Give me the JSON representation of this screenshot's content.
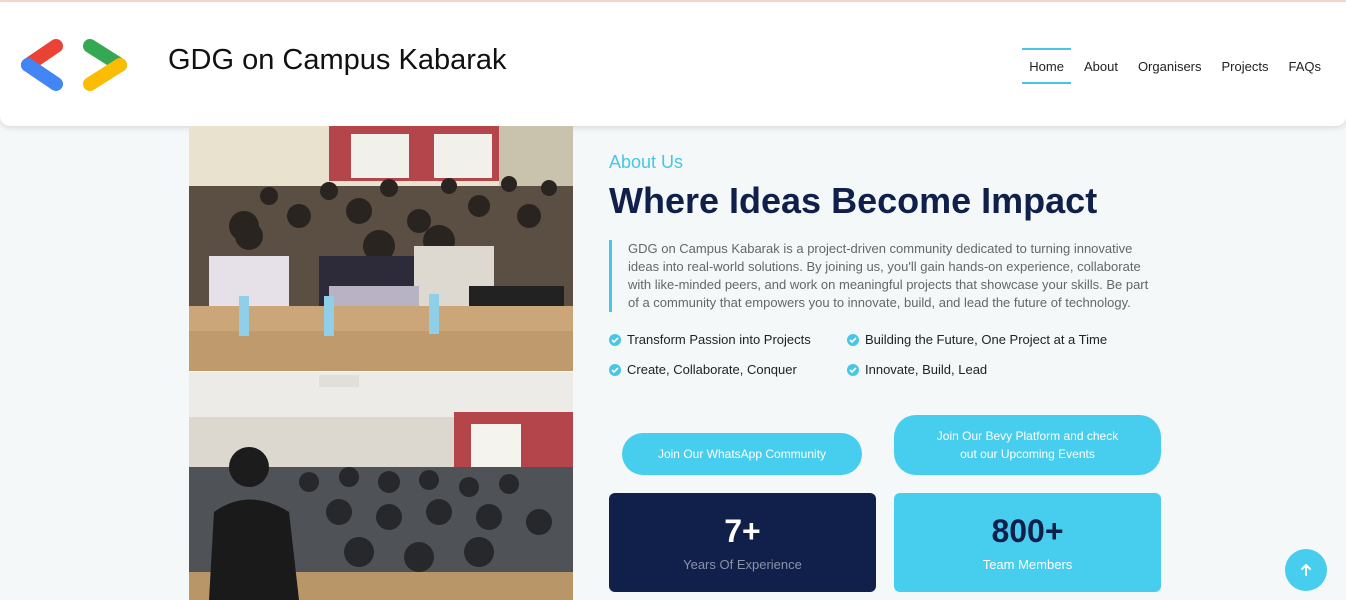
{
  "header": {
    "site_title": "GDG on Campus Kabarak",
    "nav": [
      {
        "label": "Home",
        "active": true
      },
      {
        "label": "About",
        "active": false
      },
      {
        "label": "Organisers",
        "active": false
      },
      {
        "label": "Projects",
        "active": false
      },
      {
        "label": "FAQs",
        "active": false
      }
    ]
  },
  "about": {
    "kicker": "About Us",
    "headline": "Where Ideas Become Impact",
    "description": "GDG on Campus Kabarak is a project-driven community dedicated to turning innovative ideas into real-world solutions. By joining us, you'll gain hands-on experience, collaborate with like-minded peers, and work on meaningful projects that showcase your skills. Be part of a community that empowers you to innovate, build, and lead the future of technology.",
    "features": [
      "Transform Passion into Projects",
      "Building the Future, One Project at a Time",
      "Create, Collaborate, Conquer",
      "Innovate, Build, Lead"
    ],
    "whatsapp_button": "Join Our WhatsApp Community",
    "bevy_button": "Join Our Bevy Platform and check out our Upcoming Events",
    "stats": [
      {
        "value": "7+",
        "label": "Years Of Experience"
      },
      {
        "value": "800+",
        "label": "Team Members"
      }
    ]
  },
  "colors": {
    "accent": "#47c6e6",
    "navy": "#10204a",
    "background": "#f4f8f9"
  },
  "icons": {
    "logo": "gdg-logo",
    "feature_bullet": "check-circle-icon",
    "back_to_top": "arrow-up-icon"
  }
}
